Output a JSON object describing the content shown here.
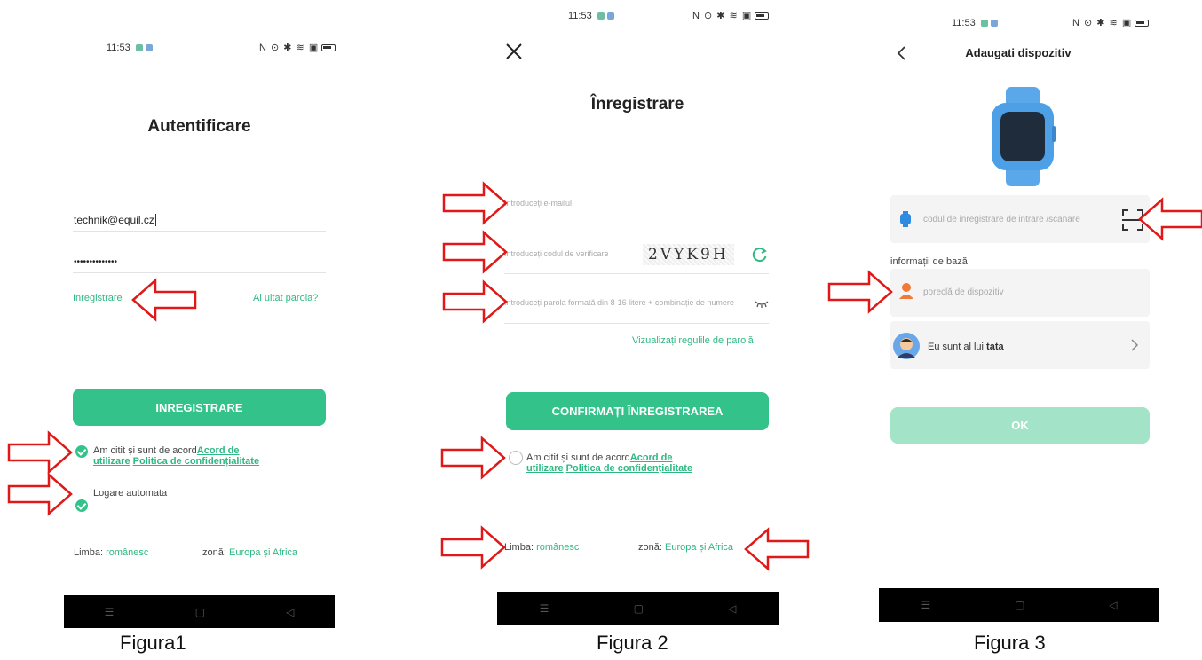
{
  "status": {
    "time": "11:53"
  },
  "screen1": {
    "title": "Autentificare",
    "email_value": "technik@equil.cz",
    "password_value": "••••••••••••••",
    "register_link": "Inregistrare",
    "forgot_link": "Ai uitat parola?",
    "register_button": "INREGISTRARE",
    "agree_prefix": "Am citit și sunt de acord",
    "agree_terms_1": "Acord de",
    "agree_terms_2": "utilizare",
    "agree_privacy": "Politica de confidențialitate",
    "auto_login": "Logare automata",
    "language_label": "Limba:",
    "language_value": "românesc",
    "zone_label": "zonă:",
    "zone_value": "Europa și Africa",
    "caption": "Figura1"
  },
  "screen2": {
    "title": "Înregistrare",
    "email_placeholder": "Introduceți e-mailul",
    "code_placeholder": "Introduceți codul de verificare",
    "captcha_text": "2VYK9H",
    "password_placeholder": "Introduceți parola formată din 8-16 litere + combinație de numere",
    "password_rules_link": "Vizualizați regulile de parolă",
    "confirm_button": "CONFIRMAȚI ÎNREGISTRAREA",
    "agree_prefix": "Am citit și sunt de acord",
    "agree_terms_1": "Acord de",
    "agree_terms_2": "utilizare",
    "agree_privacy": "Politica de confidențialitate",
    "language_label": "Limba:",
    "language_value": "românesc",
    "zone_label": "zonă:",
    "zone_value": "Europa și Africa",
    "caption": "Figura 2"
  },
  "screen3": {
    "title": "Adaugati dispozitiv",
    "code_placeholder": "codul de inregistrare de intrare /scanare",
    "section_label": "informații de bază",
    "nickname_placeholder": "poreclă de dispozitiv",
    "relation_prefix": "Eu sunt al lui",
    "relation_value": "tata",
    "ok_button": "OK",
    "caption": "Figura 3"
  },
  "colors": {
    "accent": "#33c38a",
    "arrow": "#e01818",
    "ok_disabled": "#a3e3c8"
  },
  "icons": {
    "back": "chevron-left-icon",
    "close": "close-icon",
    "refresh": "refresh-icon",
    "scan": "scan-icon",
    "eye_off": "eye-off-icon",
    "chevron_right": "chevron-right-icon"
  }
}
